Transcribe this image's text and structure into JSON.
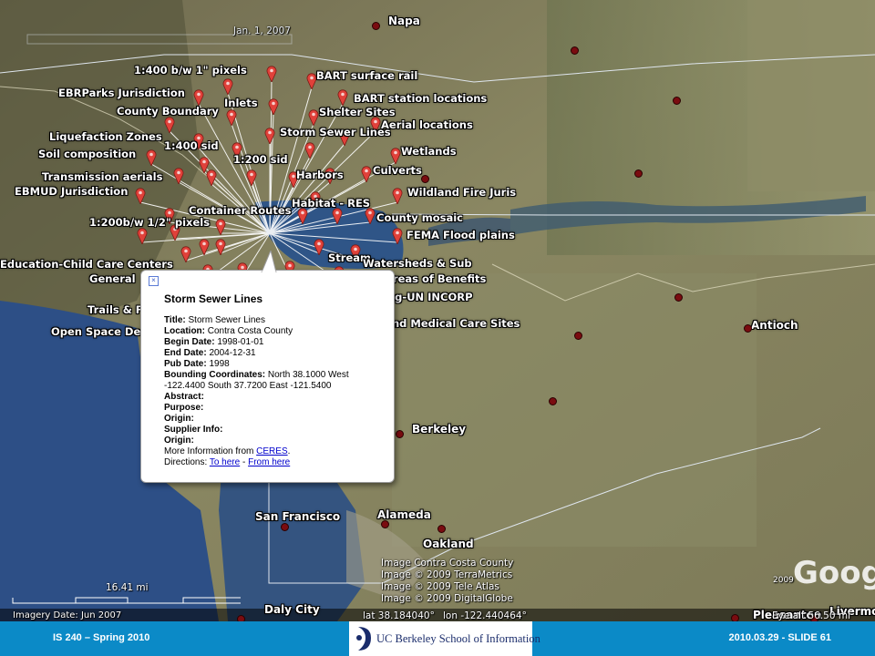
{
  "map": {
    "date_label": "Jan. 1, 2007",
    "places": [
      {
        "name": "Napa"
      },
      {
        "name": "Antioch"
      },
      {
        "name": "Berkeley"
      },
      {
        "name": "San Francisco"
      },
      {
        "name": "Alameda"
      },
      {
        "name": "Oakland"
      },
      {
        "name": "Daly City"
      },
      {
        "name": "Pleasanton"
      },
      {
        "name": "Livermore"
      }
    ],
    "layers": [
      "1:400 b/w 1\" pixels",
      "EBRParks Jurisdiction",
      "County Boundary",
      "Liquefaction Zones",
      "1:400 sid",
      "Soil composition",
      "Transmission aerials",
      "EBMUD Jurisdiction",
      "1:200b/w 1/2\" pixels",
      "Education-Child Care Centers",
      "General",
      "Trails & F",
      "Open Space De",
      "BART surface rail",
      "BART station locations",
      "Shelter Sites",
      "Aerial locations",
      "Inlets",
      "Storm Sewer Lines",
      "Wetlands",
      "1:200 sid",
      "Harbors",
      "Culverts",
      "Wildland Fire Juris",
      "Container Routes",
      "Habitat - RES",
      "County mosaic",
      "FEMA Flood plains",
      "Stream",
      "Watersheds & Sub",
      "Areas of Benefits",
      "ng-UN INCORP",
      "nd Medical Care Sites"
    ],
    "scale_label": "16.41 mi",
    "imagery_date": "Imagery Date: Jun 2007",
    "lat": "lat  38.184040°",
    "lon": "lon  -122.440464°",
    "eye_alt": "Eye alt  56.50 mi",
    "attributions": [
      "Image Contra Costa County",
      "Image © 2009 TerraMetrics",
      "Image © 2009 Tele Atlas",
      "Image © 2009 DigitalGlobe"
    ],
    "google_logo": "Google",
    "google_year": "2009"
  },
  "popup": {
    "close_glyph": "×",
    "heading": "Storm Sewer Lines",
    "fields": [
      {
        "label": "Title:",
        "value": " Storm Sewer Lines"
      },
      {
        "label": "Location:",
        "value": " Contra Costa County"
      },
      {
        "label": "Begin Date:",
        "value": " 1998-01-01"
      },
      {
        "label": "End Date:",
        "value": " 2004-12-31"
      },
      {
        "label": "Pub Date:",
        "value": " 1998"
      },
      {
        "label": "Bounding Coordinates:",
        "value": " North 38.1000 West -122.4400 South 37.7200 East -121.5400"
      },
      {
        "label": "Abstract:",
        "value": ""
      },
      {
        "label": "Purpose:",
        "value": ""
      },
      {
        "label": "Origin:",
        "value": ""
      },
      {
        "label": "Supplier Info:",
        "value": ""
      },
      {
        "label": "Origin:",
        "value": ""
      }
    ],
    "more_info_prefix": "More Information from ",
    "more_info_link": "CERES",
    "more_info_suffix": ".",
    "directions_prefix": "Directions: ",
    "directions_to": "To here",
    "directions_sep": " - ",
    "directions_from": "From here"
  },
  "footer": {
    "left": "IS 240 – Spring 2010",
    "right": "2010.03.29  -  SLIDE 61",
    "logo_text": "UC Berkeley School of Information"
  },
  "colors": {
    "footer_bg": "#0b8ac7",
    "pin": "#e0413a",
    "water": "#2d4f86"
  }
}
